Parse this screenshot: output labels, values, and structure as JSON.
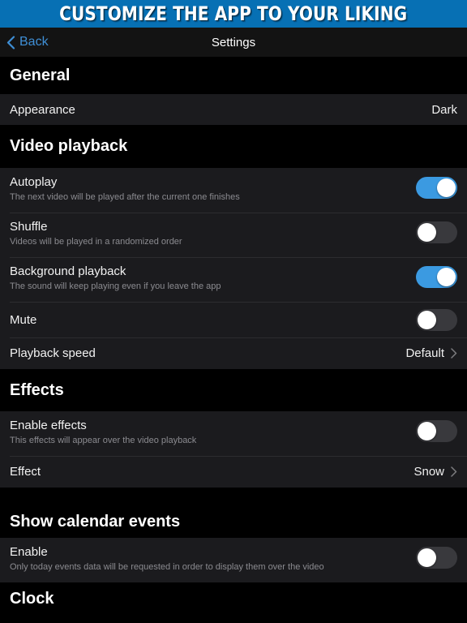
{
  "promo": {
    "text": "CUSTOMIZE THE APP TO YOUR LIKING",
    "background_color": "#0770b4",
    "text_color": "#ffffff"
  },
  "navbar": {
    "back_label": "Back",
    "title": "Settings",
    "back_icon": "chevron-left-icon",
    "accent_color": "#3f8fd6"
  },
  "theme": {
    "page_background": "#000000",
    "row_background": "#1b1b1e",
    "divider_color": "#2c2c2f",
    "primary_text": "#f2f2f2",
    "secondary_text": "#8b8b90",
    "switch_on_color": "#3b9ae1",
    "switch_off_color": "#39393d",
    "switch_knob_color": "#ffffff"
  },
  "sections": [
    {
      "id": "general",
      "header": "General",
      "rows": [
        {
          "id": "appearance",
          "title": "Appearance",
          "subtitle": "",
          "type": "value",
          "value": "Dark",
          "has_chevron": false
        }
      ]
    },
    {
      "id": "video-playback",
      "header": "Video playback",
      "rows": [
        {
          "id": "autoplay",
          "title": "Autoplay",
          "subtitle": "The next video will be played after the current one finishes",
          "type": "switch",
          "value": "on"
        },
        {
          "id": "shuffle",
          "title": "Shuffle",
          "subtitle": "Videos will be played in a randomized order",
          "type": "switch",
          "value": "off"
        },
        {
          "id": "background-playback",
          "title": "Background playback",
          "subtitle": "The sound will keep playing even if you leave the app",
          "type": "switch",
          "value": "on"
        },
        {
          "id": "mute",
          "title": "Mute",
          "subtitle": "",
          "type": "switch",
          "value": "off"
        },
        {
          "id": "playback-speed",
          "title": "Playback speed",
          "subtitle": "",
          "type": "value",
          "value": "Default",
          "has_chevron": true
        }
      ]
    },
    {
      "id": "effects",
      "header": "Effects",
      "rows": [
        {
          "id": "enable-effects",
          "title": "Enable effects",
          "subtitle": "This effects will appear over the video playback",
          "type": "switch",
          "value": "off"
        },
        {
          "id": "effect",
          "title": "Effect",
          "subtitle": "",
          "type": "value",
          "value": "Snow",
          "has_chevron": true
        }
      ]
    },
    {
      "id": "show-calendar-events",
      "header": "Show calendar events",
      "rows": [
        {
          "id": "calendar-enable",
          "title": "Enable",
          "subtitle": "Only today events data will be requested in order to display them over the video",
          "type": "switch",
          "value": "off"
        }
      ]
    },
    {
      "id": "clock",
      "header": "Clock",
      "rows": []
    }
  ]
}
